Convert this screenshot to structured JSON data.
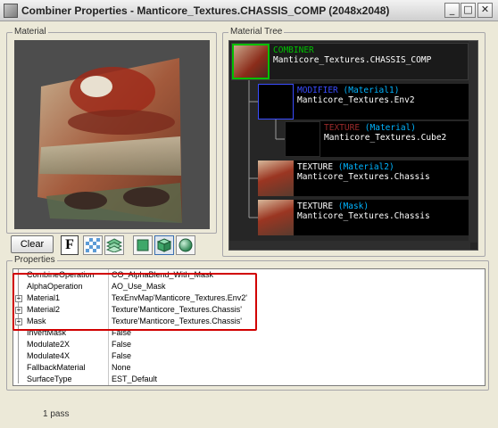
{
  "window": {
    "title": "Combiner Properties - Manticore_Textures.CHASSIS_COMP (2048x2048)",
    "buttons": {
      "minimize": "_",
      "maximize": "□",
      "close": "✕"
    }
  },
  "material_panel": {
    "label": "Material"
  },
  "toolbar": {
    "clear_label": "Clear",
    "font_label": "F"
  },
  "material_tree": {
    "label": "Material Tree",
    "nodes": [
      {
        "type": "COMBINER",
        "slot": "",
        "path": "Manticore_Textures.CHASSIS_COMP",
        "type_color": "#00c000"
      },
      {
        "type": "MODIFIER",
        "slot": "(Material1)",
        "path": "Manticore_Textures.Env2",
        "type_color": "#3a4cff"
      },
      {
        "type": "TEXTURE",
        "slot": "(Material)",
        "path": "Manticore_Textures.Cube2",
        "type_color": "#9a2a2a"
      },
      {
        "type": "TEXTURE",
        "slot": "(Material2)",
        "path": "Manticore_Textures.Chassis",
        "type_color": "#ffffff"
      },
      {
        "type": "TEXTURE",
        "slot": "(Mask)",
        "path": "Manticore_Textures.Chassis",
        "type_color": "#ffffff"
      }
    ],
    "slot_color": "#00b4ff"
  },
  "properties": {
    "label": "Properties",
    "rows": [
      {
        "name": "CombineOperation",
        "value": "CO_AlphaBlend_With_Mask",
        "expandable": false
      },
      {
        "name": "AlphaOperation",
        "value": "AO_Use_Mask",
        "expandable": false
      },
      {
        "name": "Material1",
        "value": "TexEnvMap'Manticore_Textures.Env2'",
        "expandable": true
      },
      {
        "name": "Material2",
        "value": "Texture'Manticore_Textures.Chassis'",
        "expandable": true
      },
      {
        "name": "Mask",
        "value": "Texture'Manticore_Textures.Chassis'",
        "expandable": true
      },
      {
        "name": "InvertMask",
        "value": "False",
        "expandable": false
      },
      {
        "name": "Modulate2X",
        "value": "False",
        "expandable": false
      },
      {
        "name": "Modulate4X",
        "value": "False",
        "expandable": false
      },
      {
        "name": "FallbackMaterial",
        "value": "None",
        "expandable": false
      },
      {
        "name": "SurfaceType",
        "value": "EST_Default",
        "expandable": false
      }
    ]
  },
  "status": {
    "text": "1 pass"
  },
  "colors": {
    "highlight": "#d10000",
    "background": "#ece9d8"
  }
}
